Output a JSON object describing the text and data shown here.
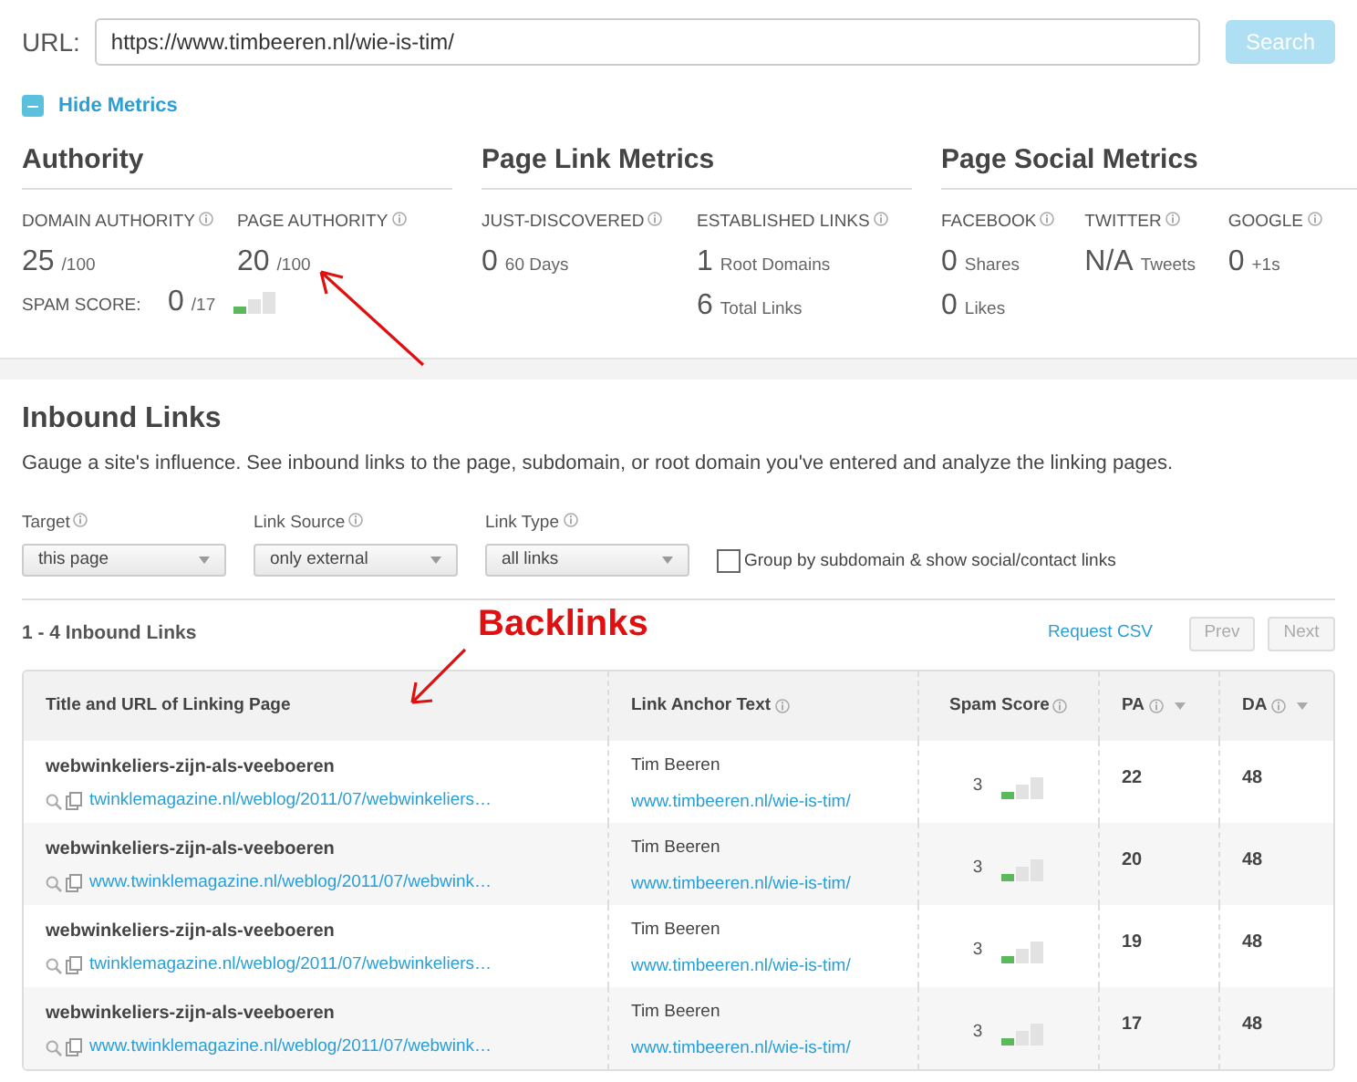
{
  "url_bar": {
    "label": "URL:",
    "value": "https://www.timbeeren.nl/wie-is-tim/",
    "button": "Search"
  },
  "metrics_toggle": {
    "label": "Hide Metrics",
    "expanded": true
  },
  "metric_groups": [
    {
      "title": "Authority",
      "metrics": [
        {
          "label": "DOMAIN AUTHORITY",
          "lines": [
            {
              "value": "25",
              "unit": "/100"
            }
          ]
        },
        {
          "label": "PAGE AUTHORITY",
          "lines": [
            {
              "value": "20",
              "unit": "/100"
            }
          ]
        }
      ],
      "spam": {
        "label": "SPAM SCORE:",
        "value": "0",
        "unit": "/17",
        "level": 0.33
      }
    },
    {
      "title": "Page Link Metrics",
      "metrics": [
        {
          "label": "JUST-DISCOVERED",
          "lines": [
            {
              "value": "0",
              "unit": "60 Days"
            }
          ]
        },
        {
          "label": "ESTABLISHED LINKS",
          "lines": [
            {
              "value": "1",
              "unit": "Root Domains"
            },
            {
              "value": "6",
              "unit": "Total Links"
            }
          ]
        }
      ]
    },
    {
      "title": "Page Social Metrics",
      "metrics": [
        {
          "label": "FACEBOOK",
          "lines": [
            {
              "value": "0",
              "unit": "Shares"
            },
            {
              "value": "0",
              "unit": "Likes"
            }
          ]
        },
        {
          "label": "TWITTER",
          "lines": [
            {
              "value": "N/A",
              "unit": "Tweets"
            }
          ]
        },
        {
          "label": "GOOGLE",
          "lines": [
            {
              "value": "0",
              "unit": "+1s"
            }
          ]
        }
      ]
    }
  ],
  "inbound": {
    "title": "Inbound Links",
    "description": "Gauge a site's influence. See inbound links to the page, subdomain, or root domain you've entered and analyze the linking pages.",
    "filters": [
      {
        "label": "Target",
        "value": "this page"
      },
      {
        "label": "Link Source",
        "value": "only external"
      },
      {
        "label": "Link Type",
        "value": "all links"
      }
    ],
    "group_checkbox": {
      "label": "Group by subdomain & show social/contact links",
      "checked": false
    },
    "count": "1 - 4 Inbound Links",
    "request_csv": "Request CSV",
    "prev": "Prev",
    "next": "Next"
  },
  "annotation": "Backlinks",
  "table": {
    "columns": [
      {
        "label": "Title and URL of Linking Page",
        "info": false,
        "sort": false
      },
      {
        "label": "Link Anchor Text",
        "info": true,
        "sort": false
      },
      {
        "label": "Spam Score",
        "info": true,
        "sort": false
      },
      {
        "label": "PA",
        "info": true,
        "sort": true
      },
      {
        "label": "DA",
        "info": true,
        "sort": true
      }
    ],
    "rows": [
      {
        "title": "webwinkeliers-zijn-als-veeboeren",
        "url": "twinklemagazine.nl/weblog/2011/07/webwinkeliers…",
        "anchor": "Tim Beeren",
        "anchor_url": "www.timbeeren.nl/wie-is-tim/",
        "spam": "3",
        "level": 0.33,
        "pa": "22",
        "da": "48"
      },
      {
        "title": "webwinkeliers-zijn-als-veeboeren",
        "url": "www.twinklemagazine.nl/weblog/2011/07/webwink…",
        "anchor": "Tim Beeren",
        "anchor_url": "www.timbeeren.nl/wie-is-tim/",
        "spam": "3",
        "level": 0.33,
        "pa": "20",
        "da": "48"
      },
      {
        "title": "webwinkeliers-zijn-als-veeboeren",
        "url": "twinklemagazine.nl/weblog/2011/07/webwinkeliers…",
        "anchor": "Tim Beeren",
        "anchor_url": "www.timbeeren.nl/wie-is-tim/",
        "spam": "3",
        "level": 0.33,
        "pa": "19",
        "da": "48"
      },
      {
        "title": "webwinkeliers-zijn-als-veeboeren",
        "url": "www.twinklemagazine.nl/weblog/2011/07/webwink…",
        "anchor": "Tim Beeren",
        "anchor_url": "www.timbeeren.nl/wie-is-tim/",
        "spam": "3",
        "level": 0.33,
        "pa": "17",
        "da": "48"
      }
    ]
  }
}
